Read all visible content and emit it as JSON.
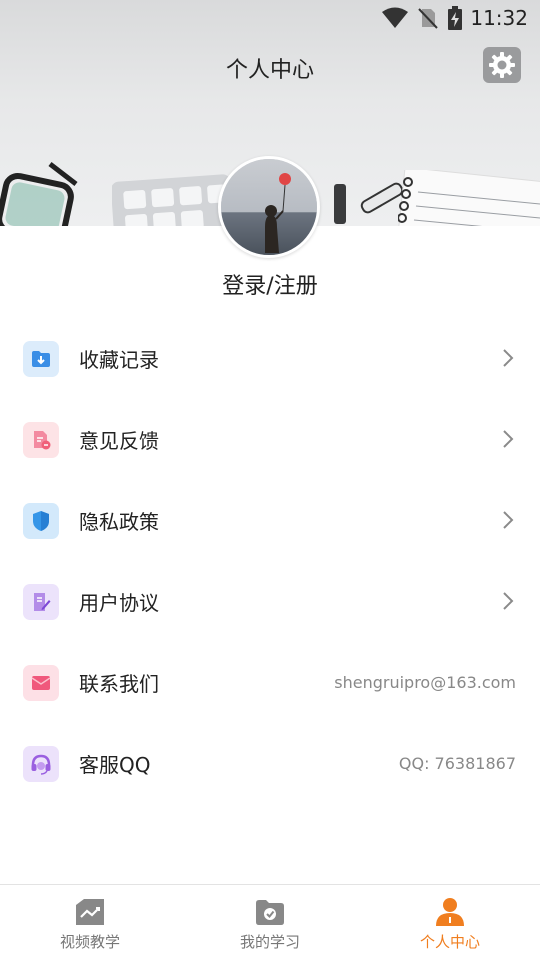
{
  "status_bar": {
    "time": "11:32"
  },
  "header": {
    "title": "个人中心",
    "settings_icon": "gear-icon"
  },
  "profile": {
    "login_label": "登录/注册"
  },
  "menu": [
    {
      "label": "收藏记录",
      "icon": "folder-download-icon",
      "icon_bg": "#dcecfb",
      "icon_color": "#3a8ee6",
      "value": "",
      "chevron": true
    },
    {
      "label": "意见反馈",
      "icon": "feedback-doc-icon",
      "icon_bg": "#fde3e6",
      "icon_color": "#f0607a",
      "value": "",
      "chevron": true
    },
    {
      "label": "隐私政策",
      "icon": "shield-icon",
      "icon_bg": "#d3e9fb",
      "icon_color": "#3596e8",
      "value": "",
      "chevron": true
    },
    {
      "label": "用户协议",
      "icon": "document-edit-icon",
      "icon_bg": "#ece3fb",
      "icon_color": "#9b6bdf",
      "value": "",
      "chevron": true
    },
    {
      "label": "联系我们",
      "icon": "mail-icon",
      "icon_bg": "#fde0e6",
      "icon_color": "#f0587c",
      "value": "shengruipro@163.com",
      "chevron": false
    },
    {
      "label": "客服QQ",
      "icon": "headset-icon",
      "icon_bg": "#ece2fb",
      "icon_color": "#9a5fe0",
      "value": "QQ: 76381867",
      "chevron": false
    }
  ],
  "bottom_nav": [
    {
      "label": "视频教学",
      "icon": "video-chart-icon",
      "active": false
    },
    {
      "label": "我的学习",
      "icon": "folder-check-icon",
      "active": false
    },
    {
      "label": "个人中心",
      "icon": "person-icon",
      "active": true
    }
  ],
  "colors": {
    "accent": "#f07e1f",
    "inactive": "#777777",
    "settings_bg": "#9a9b9d"
  }
}
